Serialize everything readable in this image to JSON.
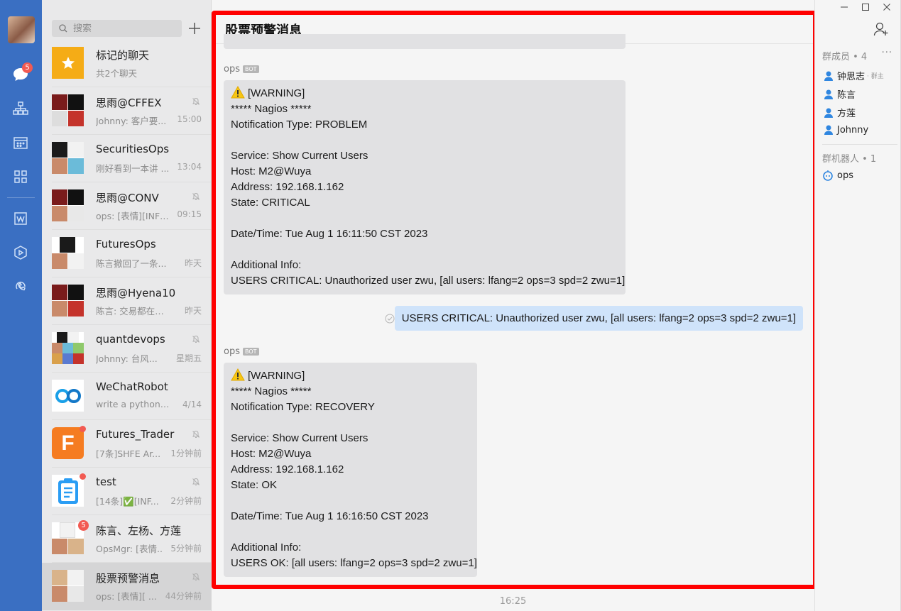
{
  "nav": {
    "unread_badge": "5",
    "icons": [
      "chat-icon",
      "org-chart-icon",
      "calendar-icon",
      "apps-grid-icon",
      "docs-icon",
      "workbench-icon",
      "call-icon"
    ]
  },
  "search": {
    "placeholder": "搜索"
  },
  "chats": [
    {
      "name": "标记的聊天",
      "preview": "共2个聊天",
      "time": "",
      "muted": false
    },
    {
      "name": "思雨@CFFEX",
      "preview": "Johnny: 客户要...",
      "time": "15:00",
      "muted": true
    },
    {
      "name": "SecuritiesOps",
      "preview": "刚好看到一本讲 ...",
      "time": "13:04",
      "muted": false
    },
    {
      "name": "思雨@CONV",
      "preview": "ops: [表情][INFO...",
      "time": "09:15",
      "muted": true
    },
    {
      "name": "FuturesOps",
      "preview": "陈言撤回了一条...",
      "time": "昨天",
      "muted": false
    },
    {
      "name": "思雨@Hyena10",
      "preview": "陈言: 交易都在跑了",
      "time": "昨天",
      "muted": false
    },
    {
      "name": "quantdevops",
      "preview": "Johnny: 台风...",
      "time": "星期五",
      "muted": true
    },
    {
      "name": "WeChatRobot",
      "preview": "write a python c...",
      "time": "4/14",
      "muted": false
    },
    {
      "name": "Futures_Trader",
      "preview": "[7条]SHFE Ar...",
      "time": "1分钟前",
      "muted": true
    },
    {
      "name": "test",
      "preview": "[14条]✅[INF...",
      "time": "2分钟前",
      "muted": true
    },
    {
      "name": "陈言、左杨、方莲",
      "preview": "OpsMgr: [表情..",
      "time": "5分钟前",
      "muted": false,
      "badge": "5"
    },
    {
      "name": "股票预警消息",
      "preview": "ops: [表情][ ...",
      "time": "44分钟前",
      "muted": true
    }
  ],
  "conversation": {
    "title": "股票预警消息",
    "sender_name": "ops",
    "bot_tag": "BOT",
    "message1": [
      "[WARNING]",
      "***** Nagios *****",
      "Notification Type: PROBLEM",
      "",
      "Service: Show Current Users",
      "Host: M2@Wuya",
      "Address: 192.168.1.162",
      "State: CRITICAL",
      "",
      "Date/Time: Tue Aug 1 16:11:50 CST 2023",
      "",
      "Additional Info:",
      "USERS CRITICAL: Unauthorized user zwu, [all users: lfang=2 ops=3 spd=2 zwu=1]"
    ],
    "my_message": "USERS CRITICAL: Unauthorized user zwu, [all users: lfang=2 ops=3 spd=2 zwu=1]",
    "message2": [
      "[WARNING]",
      "***** Nagios *****",
      "Notification Type: RECOVERY",
      "",
      "Service: Show Current Users",
      "Host: M2@Wuya",
      "Address: 192.168.1.162",
      "State: OK",
      "",
      "Date/Time: Tue Aug 1 16:16:50 CST 2023",
      "",
      "Additional Info:",
      "USERS OK: [all users: lfang=2 ops=3 spd=2 zwu=1]"
    ],
    "bottom_time": "16:25"
  },
  "side": {
    "members_label": "群成员 • 4",
    "more": "···",
    "members": [
      {
        "name": "钟思志",
        "tag": "· 群主"
      },
      {
        "name": "陈言",
        "tag": ""
      },
      {
        "name": "方莲",
        "tag": ""
      },
      {
        "name": "Johnny",
        "tag": ""
      }
    ],
    "bots_label": "群机器人 • 1",
    "bots": [
      {
        "name": "ops"
      }
    ]
  },
  "colors": {
    "nav": "#3a6fc2",
    "highlight": "#ff0000",
    "my_bubble": "#cfe3fa",
    "badge": "#f25a52"
  }
}
